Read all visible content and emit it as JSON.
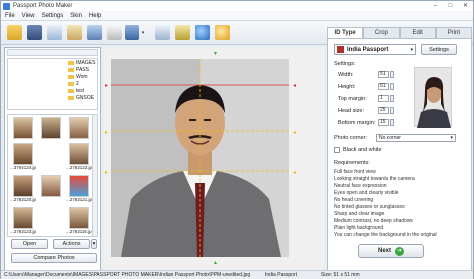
{
  "window": {
    "title": "Passport Photo Maker"
  },
  "menu": [
    "File",
    "View",
    "Settings",
    "Skin",
    "Help"
  ],
  "left": {
    "folder_label": "",
    "tree_items": [
      "IMAGES",
      "PASS",
      "Wom",
      "2",
      "test",
      "GNSOE"
    ],
    "thumbnails": [
      {
        "caption": "...3764124.jpeg"
      },
      {
        "caption": "...2763122.jpeg"
      },
      {
        "caption": "...2763120.jpeg"
      },
      {
        "caption": "...2763121.jpeg"
      },
      {
        "caption": "...2763123.jpeg"
      },
      {
        "caption": "...2763116.jpeg"
      }
    ],
    "open_button": "Open",
    "actions_button": "Actions",
    "compare_button": "Compare Photos"
  },
  "tabs": [
    {
      "label": "ID Type",
      "active": true
    },
    {
      "label": "Crop",
      "active": false
    },
    {
      "label": "Edit",
      "active": false
    },
    {
      "label": "Print",
      "active": false
    }
  ],
  "idtype": {
    "selected": "India Passport",
    "settings_button": "Settings",
    "settings_label": "Settings:",
    "fields": [
      {
        "label": "Width:",
        "value": "51"
      },
      {
        "label": "Height:",
        "value": "51"
      },
      {
        "label": "Top margin:",
        "value": "1"
      },
      {
        "label": "Head size:",
        "value": "25"
      },
      {
        "label": "Bottom margin:",
        "value": "15"
      }
    ],
    "photo_corner_label": "Photo corner:",
    "photo_corner_value": "No corner",
    "bw_label": "Black and white",
    "requirements_label": "Requirements:",
    "requirements": [
      "Full face front view",
      "Looking straight towards the camera",
      "Neutral face expression",
      "Eyes open and clearly visible",
      "No head covering",
      "No tinted glasses or sunglasses",
      "Sharp and clear image",
      "Medium contrast, no deep shadows",
      "Plain light background",
      "You can change the background in the original"
    ],
    "next_button": "Next"
  },
  "status": {
    "path": "C:\\Users\\Manager\\Documents\\IMAGES\\PASSPORT PHOTO MAKER\\Indian Passport Photo\\PPM-unedited.jpg",
    "id_type": "India Passport",
    "size": "Size: 51 x 51 mm"
  },
  "colors": {
    "accent": "#3a7bd5",
    "guide_red": "#e03030",
    "guide_yellow": "#f0c000",
    "next_green": "#3aa640"
  }
}
